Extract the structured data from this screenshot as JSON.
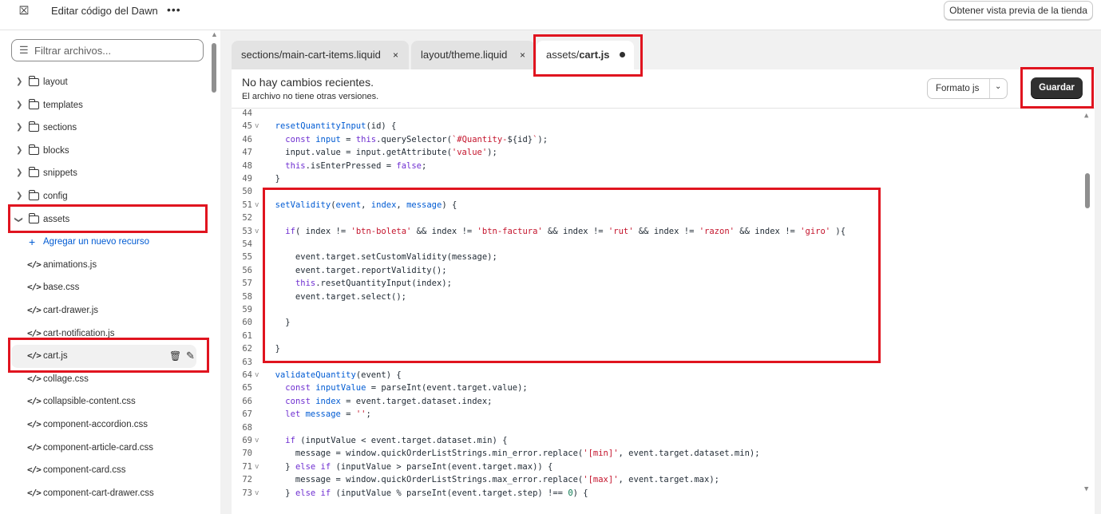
{
  "topbar": {
    "back_icon": "exit-icon",
    "title": "Editar código del Dawn",
    "more": "•••",
    "preview_button": "Obtener vista previa de la tienda"
  },
  "sidebar": {
    "filter_placeholder": "Filtrar archivos...",
    "folders": [
      {
        "label": "layout",
        "expanded": false
      },
      {
        "label": "templates",
        "expanded": false
      },
      {
        "label": "sections",
        "expanded": false
      },
      {
        "label": "blocks",
        "expanded": false
      },
      {
        "label": "snippets",
        "expanded": false
      },
      {
        "label": "config",
        "expanded": false
      },
      {
        "label": "assets",
        "expanded": true
      }
    ],
    "add_resource": "Agregar un nuevo recurso",
    "files": [
      "animations.js",
      "base.css",
      "cart-drawer.js",
      "cart-notification.js",
      "cart.js",
      "collage.css",
      "collapsible-content.css",
      "component-accordion.css",
      "component-article-card.css",
      "component-card.css",
      "component-cart-drawer.css"
    ],
    "selected_file": "cart.js"
  },
  "tabs": [
    {
      "label": "sections/main-cart-items.liquid",
      "close": "×"
    },
    {
      "label": "layout/theme.liquid",
      "close": "×"
    },
    {
      "label_prefix": "assets/",
      "label_bold": "cart.js",
      "unsaved": true
    }
  ],
  "panel": {
    "heading": "No hay cambios recientes.",
    "subheading": "El archivo no tiene otras versiones.",
    "format_button": "Formato js",
    "save_button": "Guardar"
  },
  "code_lines": [
    {
      "n": "44",
      "f": "",
      "html": ""
    },
    {
      "n": "45",
      "f": "v",
      "html": "  <span class='fn'>resetQuantityInput</span>(id) {"
    },
    {
      "n": "46",
      "f": "",
      "html": "    <span class='kw'>const</span> <span class='fn'>input</span> = <span class='kw'>this</span>.querySelector(<span class='st'>`#Quantity-</span>${id}<span class='st'>`</span>);"
    },
    {
      "n": "47",
      "f": "",
      "html": "    input.value = input.getAttribute(<span class='st'>'value'</span>);"
    },
    {
      "n": "48",
      "f": "",
      "html": "    <span class='kw'>this</span>.isEnterPressed = <span class='kw'>false</span>;"
    },
    {
      "n": "49",
      "f": "",
      "html": "  }"
    },
    {
      "n": "50",
      "f": "",
      "html": ""
    },
    {
      "n": "51",
      "f": "v",
      "html": "  <span class='fn'>setValidity</span>(<span class='fn'>event</span>, <span class='fn'>index</span>, <span class='fn'>message</span>) {"
    },
    {
      "n": "52",
      "f": "",
      "html": ""
    },
    {
      "n": "53",
      "f": "v",
      "html": "    <span class='kw'>if</span>( index != <span class='st'>'btn-boleta'</span> &amp;&amp; index != <span class='st'>'btn-factura'</span> &amp;&amp; index != <span class='st'>'rut'</span> &amp;&amp; index != <span class='st'>'razon'</span> &amp;&amp; index != <span class='st'>'giro'</span> ){"
    },
    {
      "n": "54",
      "f": "",
      "html": ""
    },
    {
      "n": "55",
      "f": "",
      "html": "      event.target.setCustomValidity(message);"
    },
    {
      "n": "56",
      "f": "",
      "html": "      event.target.reportValidity();"
    },
    {
      "n": "57",
      "f": "",
      "html": "      <span class='kw'>this</span>.resetQuantityInput(index);"
    },
    {
      "n": "58",
      "f": "",
      "html": "      event.target.select();"
    },
    {
      "n": "59",
      "f": "",
      "html": ""
    },
    {
      "n": "60",
      "f": "",
      "html": "    }"
    },
    {
      "n": "61",
      "f": "",
      "html": ""
    },
    {
      "n": "62",
      "f": "",
      "html": "  }"
    },
    {
      "n": "63",
      "f": "",
      "html": ""
    },
    {
      "n": "64",
      "f": "v",
      "html": "  <span class='fn'>validateQuantity</span>(event) {"
    },
    {
      "n": "65",
      "f": "",
      "html": "    <span class='kw'>const</span> <span class='fn'>inputValue</span> = parseInt(event.target.value);"
    },
    {
      "n": "66",
      "f": "",
      "html": "    <span class='kw'>const</span> <span class='fn'>index</span> = event.target.dataset.index;"
    },
    {
      "n": "67",
      "f": "",
      "html": "    <span class='kw'>let</span> <span class='fn'>message</span> = <span class='st'>''</span>;"
    },
    {
      "n": "68",
      "f": "",
      "html": ""
    },
    {
      "n": "69",
      "f": "v",
      "html": "    <span class='kw'>if</span> (inputValue &lt; event.target.dataset.min) {"
    },
    {
      "n": "70",
      "f": "",
      "html": "      message = window.quickOrderListStrings.min_error.replace(<span class='st'>'[min]'</span>, event.target.dataset.min);"
    },
    {
      "n": "71",
      "f": "v",
      "html": "    } <span class='kw'>else if</span> (inputValue &gt; parseInt(event.target.max)) {"
    },
    {
      "n": "72",
      "f": "",
      "html": "      message = window.quickOrderListStrings.max_error.replace(<span class='st'>'[max]'</span>, event.target.max);"
    },
    {
      "n": "73",
      "f": "v",
      "html": "    } <span class='kw'>else if</span> (inputValue % parseInt(event.target.step) !== <span class='nm'>0</span>) {"
    }
  ]
}
